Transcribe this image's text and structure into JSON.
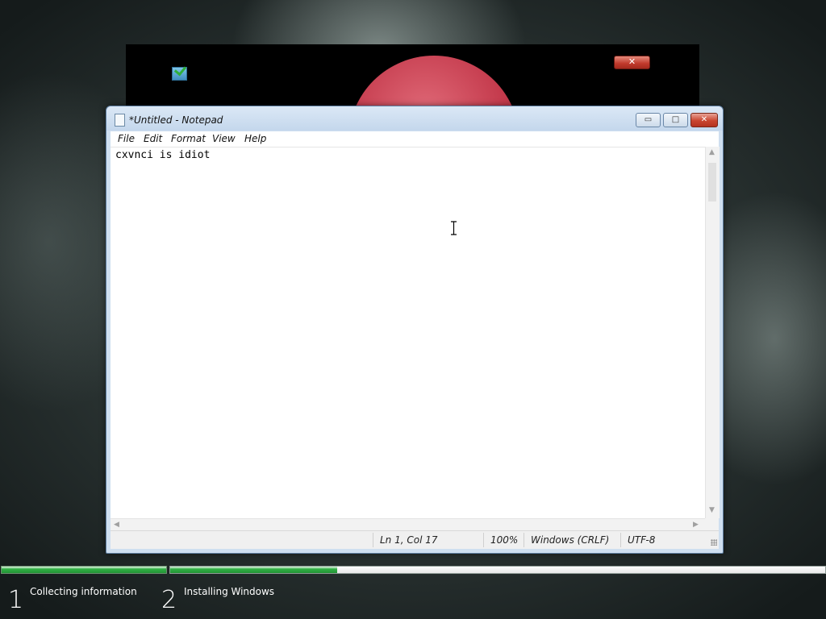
{
  "popup": {
    "title": "",
    "close_label": "✕"
  },
  "notepad": {
    "title": "*Untitled - Notepad",
    "caption_buttons": {
      "minimize": "▭",
      "maximize": "□",
      "close": "✕"
    },
    "menu": [
      "File",
      "Edit",
      "Format",
      "View",
      "Help"
    ],
    "content": "cxvnci is idiot",
    "status": {
      "position": "Ln 1, Col 17",
      "zoom": "100%",
      "line_endings": "Windows (CRLF)",
      "encoding": "UTF-8"
    }
  },
  "setup": {
    "steps": [
      {
        "number": "1",
        "label": "Collecting information"
      },
      {
        "number": "2",
        "label": "Installing Windows"
      }
    ],
    "progress": {
      "step1_fraction": 1.0,
      "step2_fraction": 0.255
    }
  },
  "colors": {
    "progress_green": "#30b043",
    "close_red": "#c9452f"
  }
}
